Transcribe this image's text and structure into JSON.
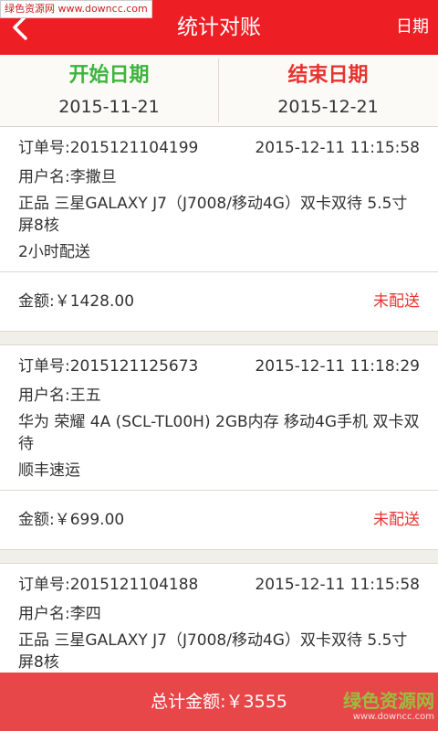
{
  "watermark_top": "绿色资源网 www.downcc.com",
  "header": {
    "title": "统计对账",
    "date_action": "日期"
  },
  "range": {
    "start_label": "开始日期",
    "start_value": "2015-11-21",
    "end_label": "结束日期",
    "end_value": "2015-12-21"
  },
  "orders": [
    {
      "order_no": "订单号:2015121104199",
      "time": "2015-12-11 11:15:58",
      "user": "用户名:李撒旦",
      "product": "正品 三星GALAXY J7（J7008/移动4G）双卡双待 5.5寸屏8核",
      "delivery": "2小时配送",
      "amount": "金额:￥1428.00",
      "status": "未配送"
    },
    {
      "order_no": "订单号:2015121125673",
      "time": "2015-12-11 11:18:29",
      "user": "用户名:王五",
      "product": "华为 荣耀 4A (SCL-TL00H) 2GB内存 移动4G手机 双卡双待",
      "delivery": "顺丰速运",
      "amount": "金额:￥699.00",
      "status": "未配送"
    },
    {
      "order_no": "订单号:2015121104188",
      "time": "2015-12-11 11:15:58",
      "user": "用户名:李四",
      "product": "正品 三星GALAXY J7（J7008/移动4G）双卡双待 5.5寸屏8核",
      "delivery": "",
      "amount": "",
      "status": ""
    }
  ],
  "footer": {
    "total": "总计金额:￥3555"
  },
  "watermark_bottom": {
    "main": "绿色资源网",
    "sub": "www.downcc.com"
  },
  "colors": {
    "header_bg": "#ee1f24",
    "start_green": "#3db53d",
    "end_red": "#e8322e",
    "total_bar": "#e8474a"
  }
}
